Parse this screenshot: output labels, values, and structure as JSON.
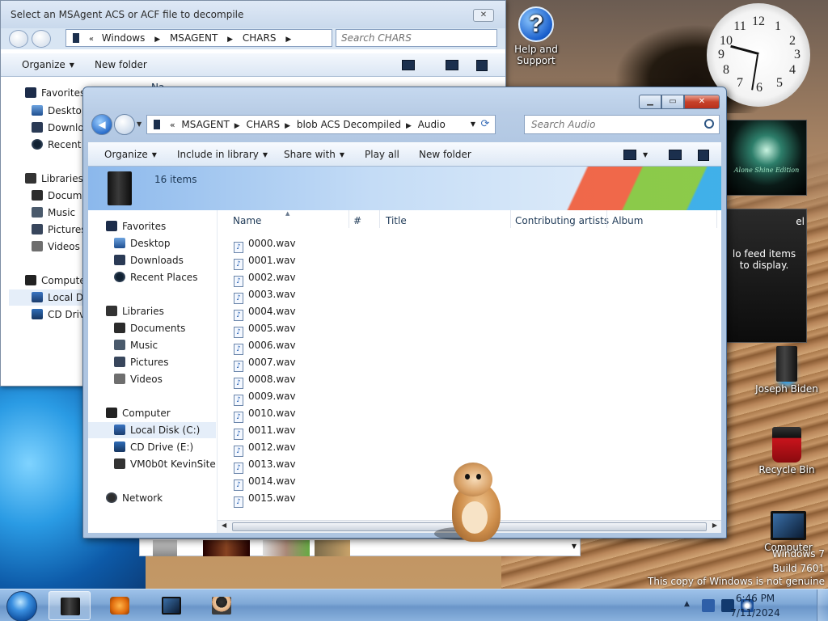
{
  "desktop": {
    "icons": {
      "help": "Help and Support",
      "user": "Joseph Biden",
      "recycle": "Recycle Bin",
      "computer": "Computer"
    },
    "feed_gadget_caption": "Alone Shine Edition",
    "feed_gadget_tag": "el",
    "feed_message": "lo feed items to display.",
    "watermark_line1": "Windows 7",
    "watermark_line2": "Build 7601",
    "watermark_line3": "This copy of Windows is not genuine"
  },
  "clock": {
    "numbers": [
      "12",
      "1",
      "2",
      "3",
      "4",
      "5",
      "6",
      "7",
      "8",
      "9",
      "10",
      "11"
    ]
  },
  "background_window": {
    "title": "Select an MSAgent ACS or ACF file to decompile",
    "close_label": "✕",
    "address": [
      "Windows",
      "MSAGENT",
      "CHARS"
    ],
    "search_placeholder": "Search CHARS",
    "commands": {
      "organize": "Organize",
      "new_folder": "New folder"
    },
    "nav": {
      "favorites": "Favorites",
      "desktop": "Desktop",
      "downloads": "Downlo",
      "recent": "Recent P",
      "libraries": "Libraries",
      "documents": "Docume",
      "music": "Music",
      "pictures": "Pictures",
      "videos": "Videos",
      "computer": "Computer",
      "local_disk": "Local Dis",
      "cd_drive": "CD Drive"
    },
    "header_name": "Na"
  },
  "window": {
    "address": [
      "MSAGENT",
      "CHARS",
      "blob ACS Decompiled",
      "Audio"
    ],
    "search_placeholder": "Search Audio",
    "commands": {
      "organize": "Organize",
      "include": "Include in library",
      "share": "Share with",
      "play_all": "Play all",
      "new_folder": "New folder"
    },
    "item_count": "16 items",
    "columns": {
      "name": "Name",
      "number": "#",
      "title": "Title",
      "artists": "Contributing artists",
      "album": "Album"
    },
    "nav": {
      "favorites": "Favorites",
      "desktop": "Desktop",
      "downloads": "Downloads",
      "recent": "Recent Places",
      "libraries": "Libraries",
      "documents": "Documents",
      "music": "Music",
      "pictures": "Pictures",
      "videos": "Videos",
      "computer": "Computer",
      "local_disk": "Local Disk (C:)",
      "cd_drive": "CD Drive (E:)",
      "share": "VM0b0t KevinSite",
      "network": "Network"
    },
    "files": [
      "0000.wav",
      "0001.wav",
      "0002.wav",
      "0003.wav",
      "0004.wav",
      "0005.wav",
      "0006.wav",
      "0007.wav",
      "0008.wav",
      "0009.wav",
      "0010.wav",
      "0011.wav",
      "0012.wav",
      "0013.wav",
      "0014.wav",
      "0015.wav"
    ]
  },
  "taskbar": {
    "time": "6:46 PM",
    "date": "7/11/2024"
  }
}
